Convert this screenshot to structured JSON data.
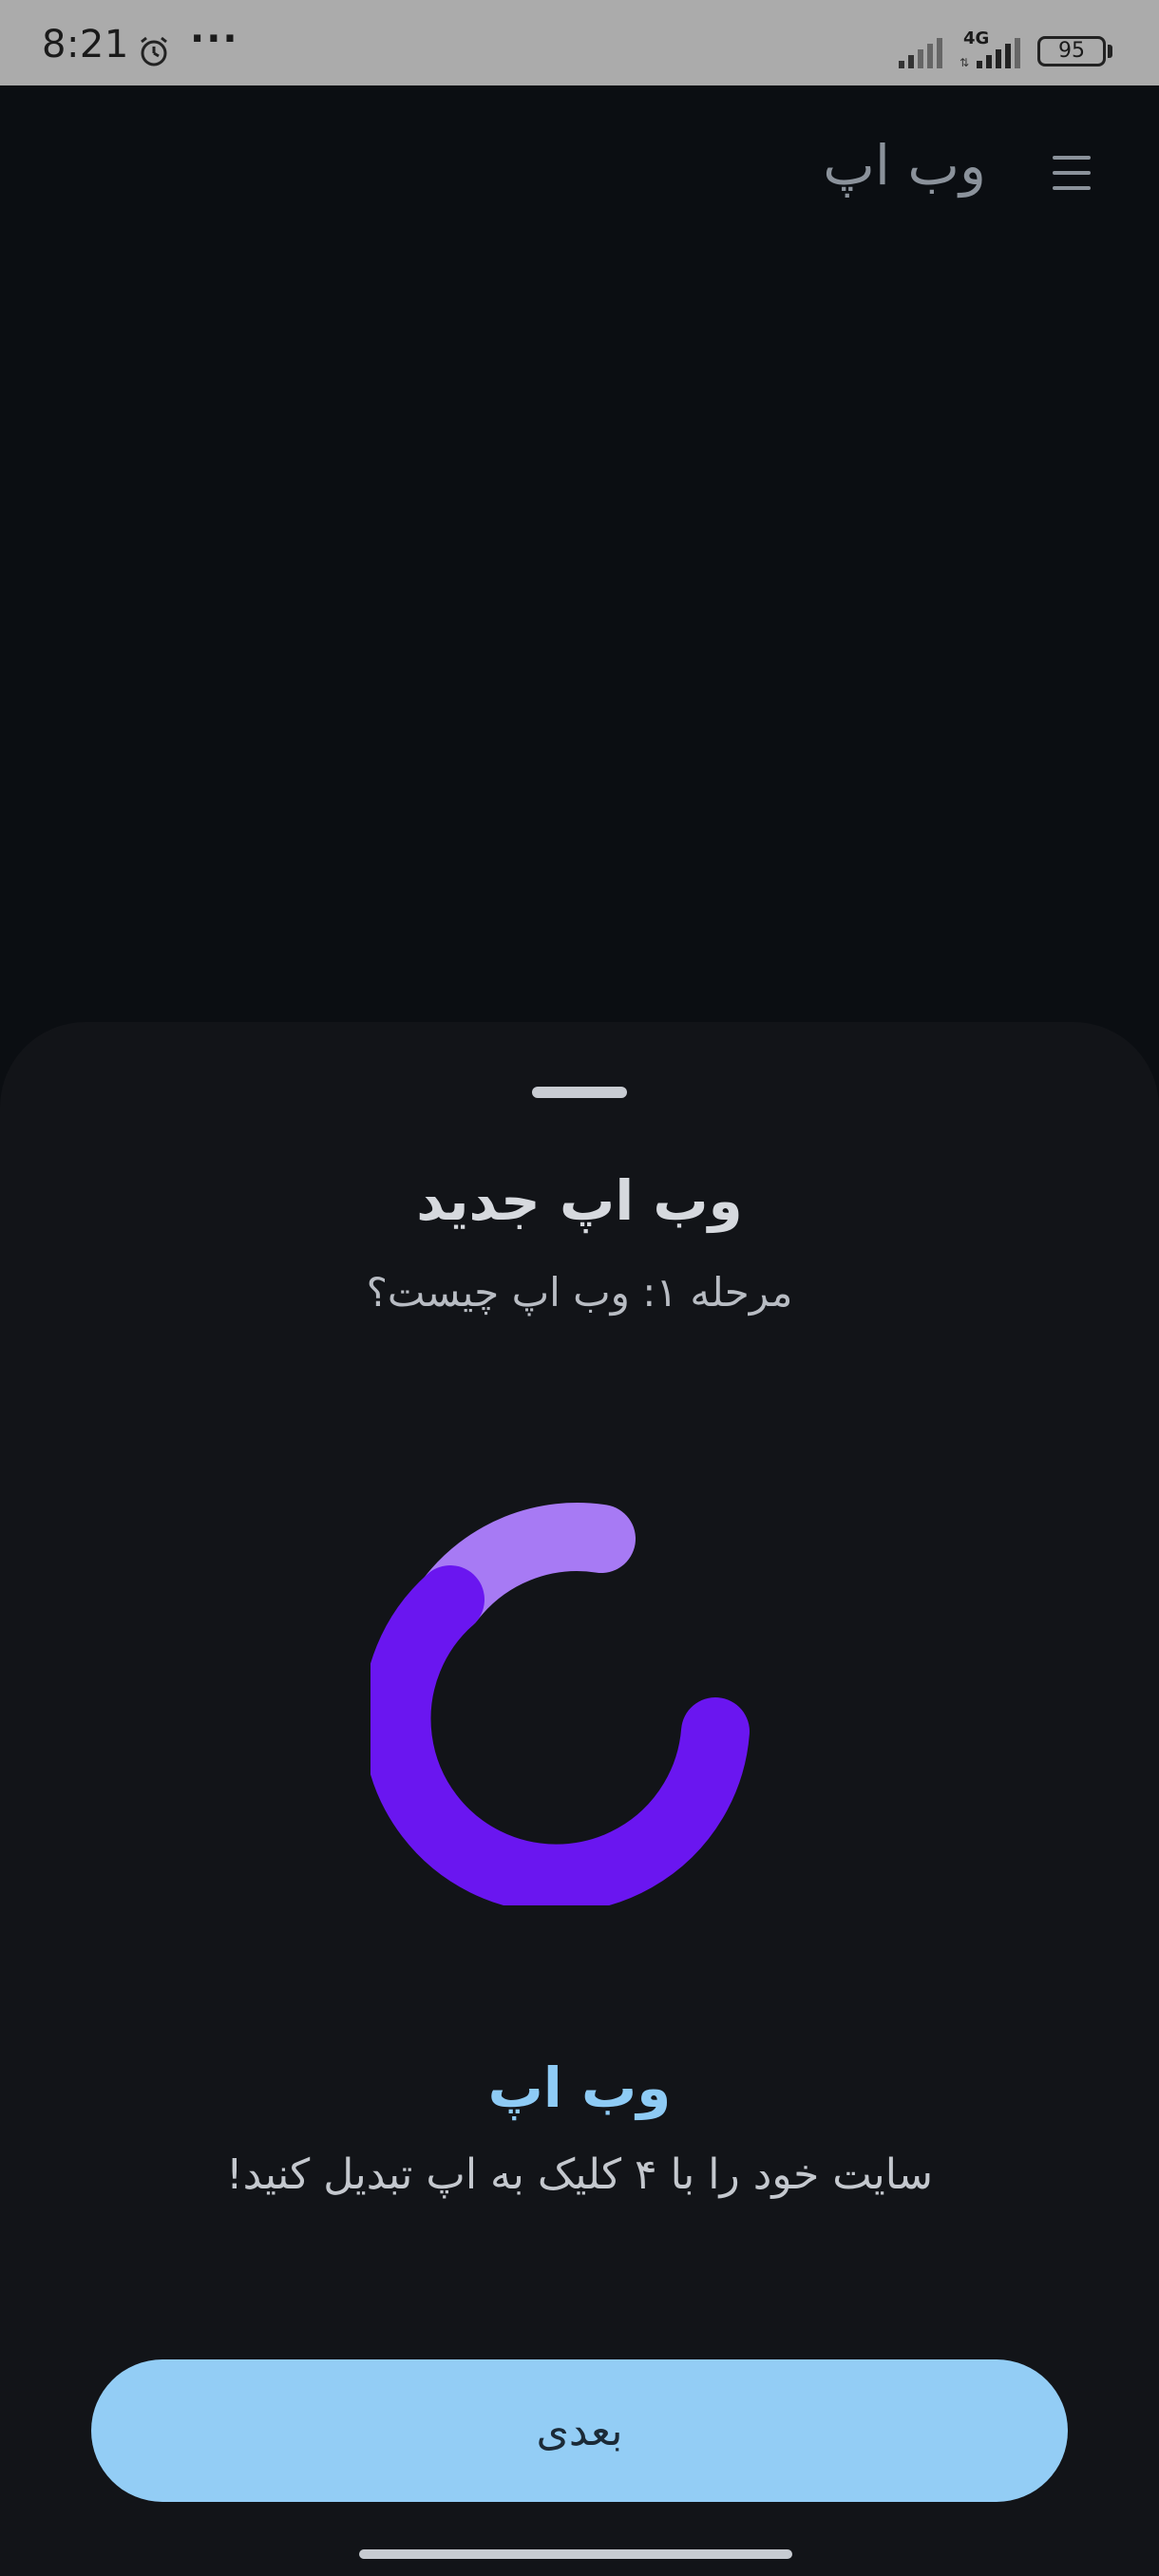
{
  "status_bar": {
    "time": "8:21",
    "alarm_icon": "alarm-clock-icon",
    "more_indicator": "···",
    "network_label": "4G",
    "battery_level": "95"
  },
  "header": {
    "title": "وب اپ",
    "menu_icon": "hamburger-menu-icon"
  },
  "sheet": {
    "title": "وب اپ جدید",
    "subtitle": "مرحله ۱: وب اپ چیست؟",
    "promo_title": "وب اپ",
    "promo_text": "سایت خود را با ۴ کلیک به اپ تبدیل کنید!",
    "next_label": "بعدی"
  },
  "colors": {
    "background": "#0b0e12",
    "sheet": "#121418",
    "accent_purple": "#6a16f0",
    "accent_lavender": "#a77af4",
    "button": "#93cdf5",
    "promo_title": "#8ecbf5"
  }
}
